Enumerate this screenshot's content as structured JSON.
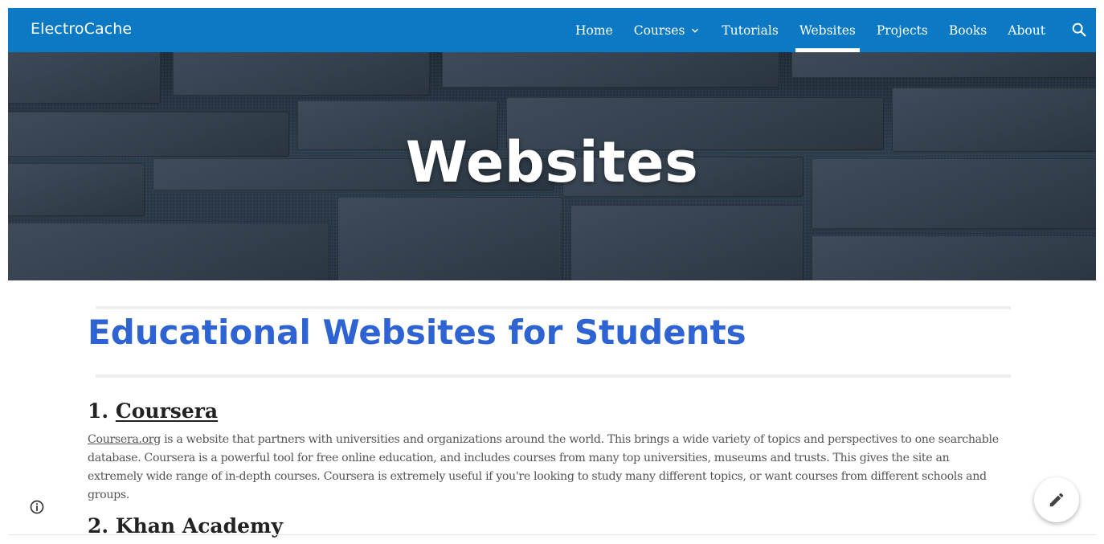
{
  "site": {
    "brand": "ElectroCache"
  },
  "nav": {
    "items": [
      {
        "label": "Home",
        "active": false,
        "dropdown": false
      },
      {
        "label": "Courses",
        "active": false,
        "dropdown": true
      },
      {
        "label": "Tutorials",
        "active": false,
        "dropdown": false
      },
      {
        "label": "Websites",
        "active": true,
        "dropdown": false
      },
      {
        "label": "Projects",
        "active": false,
        "dropdown": false
      },
      {
        "label": "Books",
        "active": false,
        "dropdown": false
      },
      {
        "label": "About",
        "active": false,
        "dropdown": false
      }
    ],
    "search_icon": "search-icon"
  },
  "hero": {
    "title": "Websites"
  },
  "main": {
    "heading": "Educational Websites for Students",
    "sections": [
      {
        "number": "1.",
        "title": "Coursera",
        "body_link": "Coursera.org",
        "body": " is a website that partners with universities and organizations around the world. This brings a wide variety of topics and perspectives to one searchable database. Coursera is a powerful tool for free online education, and includes courses from many top universities, museums and trusts. This gives the site an extremely wide range of in-depth courses. Coursera is extremely useful if you're looking to study many different topics, or want courses from different schools and groups."
      },
      {
        "number": "2.",
        "title": "Khan Academy"
      }
    ]
  },
  "floating": {
    "info_icon": "info-icon",
    "edit_icon": "pencil-icon"
  },
  "colors": {
    "header": "#0b79c4",
    "heading": "#2e63d3",
    "text": "#555555"
  }
}
